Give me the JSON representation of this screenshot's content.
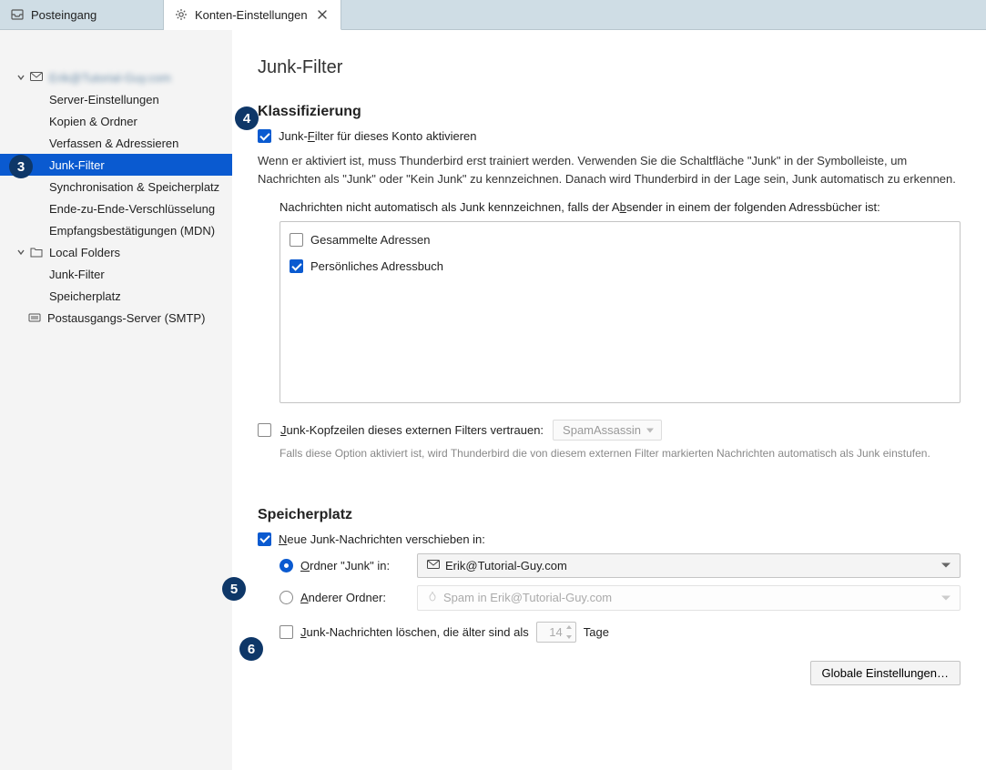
{
  "tabs": [
    {
      "label": "Posteingang",
      "active": false,
      "icon": "inbox"
    },
    {
      "label": "Konten-Einstellungen",
      "active": true,
      "icon": "gear",
      "closable": true
    }
  ],
  "sidebar": {
    "account": {
      "name_redacted": "Erik@Tutorial-Guy.com",
      "items": [
        "Server-Einstellungen",
        "Kopien & Ordner",
        "Verfassen & Adressieren",
        "Junk-Filter",
        "Synchronisation & Speicherplatz",
        "Ende-zu-Ende-Verschlüsselung",
        "Empfangsbestätigungen (MDN)"
      ],
      "selected_index": 3
    },
    "local": {
      "label": "Local Folders",
      "items": [
        "Junk-Filter",
        "Speicherplatz"
      ]
    },
    "smtp": "Postausgangs-Server (SMTP)"
  },
  "page": {
    "title": "Junk-Filter",
    "klass": {
      "heading": "Klassifizierung",
      "enable_label_pre": "Junk-",
      "enable_label_u": "F",
      "enable_label_post": "ilter für dieses Konto aktivieren",
      "enable_checked": true,
      "desc": "Wenn er aktiviert ist, muss Thunderbird erst trainiert werden. Verwenden Sie die Schaltfläche \"Junk\" in der Symbolleiste, um Nachrichten als \"Junk\" oder \"Kein Junk\" zu kennzeichnen. Danach wird Thunderbird in der Lage sein, Junk automatisch zu erkennen.",
      "whitelist_label_pre": "Nachrichten nicht automatisch als Junk kennzeichnen, falls der A",
      "whitelist_label_u": "b",
      "whitelist_label_post": "sender in einem der folgenden Adressbücher ist:",
      "books": [
        {
          "label": "Gesammelte Adressen",
          "checked": false
        },
        {
          "label": "Persönliches Adressbuch",
          "checked": true
        }
      ],
      "trust_label_pre": "",
      "trust_label_u": "J",
      "trust_label_post": "unk-Kopfzeilen dieses externen Filters vertrauen:",
      "trust_checked": false,
      "trust_filter": "SpamAssassin",
      "trust_hint": "Falls diese Option aktiviert ist, wird Thunderbird die von diesem externen Filter markierten Nachrichten automatisch als Junk einstufen."
    },
    "storage": {
      "heading": "Speicherplatz",
      "move_label_u": "N",
      "move_label_post": "eue Junk-Nachrichten verschieben in:",
      "move_checked": true,
      "radio_junk_u": "O",
      "radio_junk_post": "rdner \"Junk\" in:",
      "radio_junk_selected": true,
      "junk_account": "Erik@Tutorial-Guy.com",
      "radio_other_u": "A",
      "radio_other_post": "nderer Ordner:",
      "radio_other_selected": false,
      "other_folder": "Spam in Erik@Tutorial-Guy.com",
      "delete_label_u": "J",
      "delete_label_post": "unk-Nachrichten löschen, die älter sind als",
      "delete_checked": false,
      "delete_days": "14",
      "delete_unit": "Tage"
    },
    "footer": {
      "global_button": "Globale Einstellungen…"
    }
  },
  "markers": {
    "m3": "3",
    "m4": "4",
    "m5": "5",
    "m6": "6"
  }
}
